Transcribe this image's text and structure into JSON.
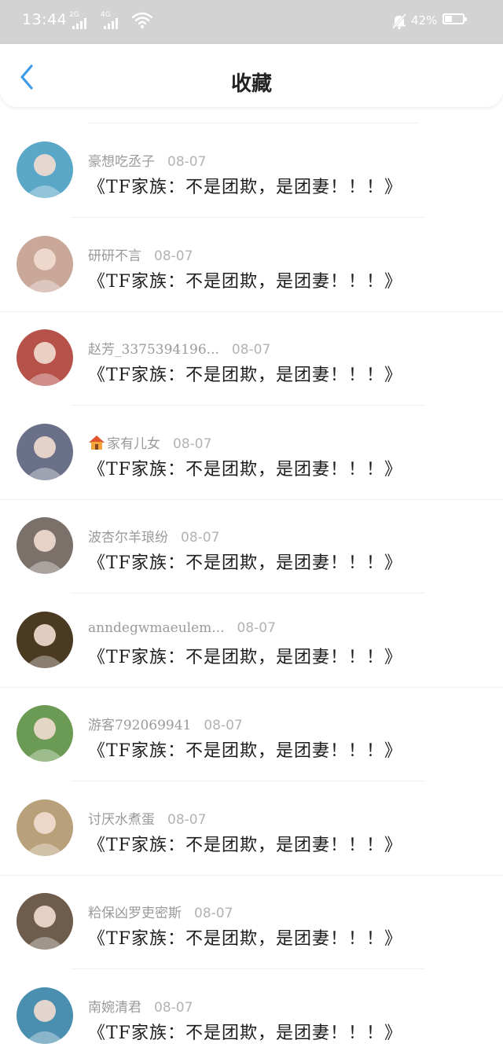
{
  "status_bar": {
    "time": "13:44",
    "signal_1_tag": "2G",
    "signal_2_tag": "4G",
    "battery_percent": "42%",
    "battery_level": 0.42,
    "icons": [
      "signal-icon",
      "signal-icon",
      "wifi-icon",
      "mute-bell-icon",
      "battery-icon"
    ]
  },
  "header": {
    "back_icon": "chevron-left-icon",
    "title": "收藏"
  },
  "colors": {
    "accent": "#3d9be9",
    "status_bar_bg": "#d3d3d3"
  },
  "items": [
    {
      "author": "豪想吃丞子",
      "date": "08-07",
      "title": "《TF家族：不是团欺，是团妻！！！》",
      "avatar_color": "#5aa7c7"
    },
    {
      "author": "研研不言",
      "date": "08-07",
      "title": "《TF家族：不是团欺，是团妻！！！》",
      "avatar_color": "#c9a89a"
    },
    {
      "author": "赵芳_3375394196...",
      "date": "08-07",
      "title": "《TF家族：不是团欺，是团妻！！！》",
      "avatar_color": "#b6524a"
    },
    {
      "author": "家有儿女",
      "author_icon": "house-icon",
      "date": "08-07",
      "title": "《TF家族：不是团欺，是团妻！！！》",
      "avatar_color": "#6a7088"
    },
    {
      "author": "波杏尔羊琅纷",
      "date": "08-07",
      "title": "《TF家族：不是团欺，是团妻！！！》",
      "avatar_color": "#7b706a"
    },
    {
      "author": "anndegwmaeulem...",
      "date": "08-07",
      "title": "《TF家族：不是团欺，是团妻！！！》",
      "avatar_color": "#4a3a22"
    },
    {
      "author": "游客792069941",
      "date": "08-07",
      "title": "《TF家族：不是团欺，是团妻！！！》",
      "avatar_color": "#6b9a54"
    },
    {
      "author": "讨厌水煮蛋",
      "date": "08-07",
      "title": "《TF家族：不是团欺，是团妻！！！》",
      "avatar_color": "#b8a07a"
    },
    {
      "author": "粭保凶罗吏密斯",
      "date": "08-07",
      "title": "《TF家族：不是团欺，是团妻！！！》",
      "avatar_color": "#6e5c4c"
    },
    {
      "author": "南婉清君",
      "date": "08-07",
      "title": "《TF家族：不是团欺，是团妻！！！》",
      "avatar_color": "#4a8fb0"
    }
  ]
}
